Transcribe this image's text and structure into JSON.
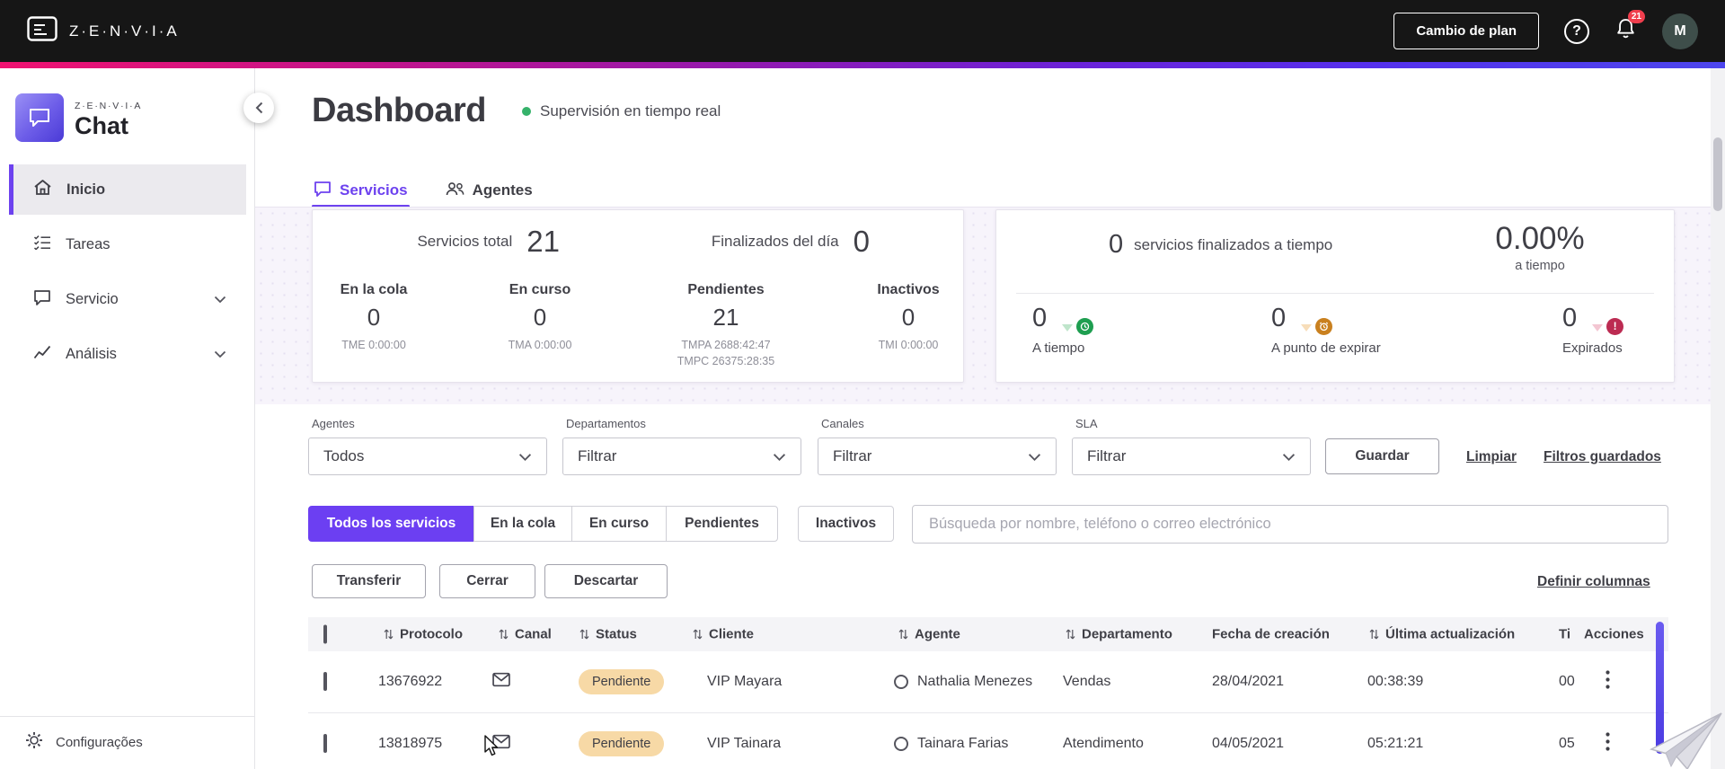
{
  "topbar": {
    "brand": "Z·E·N·V·I·A",
    "change_plan": "Cambio de plan",
    "notifications": "21",
    "avatar_initial": "M"
  },
  "sidebar": {
    "brand_small": "Z·E·N·V·I·A",
    "product": "Chat",
    "items": [
      {
        "label": "Inicio"
      },
      {
        "label": "Tareas"
      },
      {
        "label": "Servicio"
      },
      {
        "label": "Análisis"
      }
    ],
    "footer": {
      "label": "Configurações"
    }
  },
  "header": {
    "title": "Dashboard",
    "live_status": "Supervisión en tiempo real",
    "tabs": [
      {
        "label": "Servicios"
      },
      {
        "label": "Agentes"
      }
    ]
  },
  "stats": {
    "left": {
      "total_label": "Servicios total",
      "total_value": "21",
      "finished_label": "Finalizados del día",
      "finished_value": "0",
      "columns": [
        {
          "label": "En la cola",
          "value": "0",
          "sub": [
            "TME 0:00:00"
          ]
        },
        {
          "label": "En curso",
          "value": "0",
          "sub": [
            "TMA 0:00:00"
          ]
        },
        {
          "label": "Pendientes",
          "value": "21",
          "sub": [
            "TMPA 2688:42:47",
            "TMPC 26375:28:35"
          ]
        },
        {
          "label": "Inactivos",
          "value": "0",
          "sub": [
            "TMI 0:00:00"
          ]
        }
      ]
    },
    "right": {
      "on_time_value": "0",
      "on_time_label": "servicios finalizados a tiempo",
      "percent": "0.00%",
      "percent_label": "a tiempo",
      "items": [
        {
          "value": "0",
          "label": "A tiempo"
        },
        {
          "value": "0",
          "label": "A punto de expirar"
        },
        {
          "value": "0",
          "label": "Expirados"
        }
      ]
    }
  },
  "filters": {
    "agents_label": "Agentes",
    "agents_value": "Todos",
    "departments_label": "Departamentos",
    "departments_value": "Filtrar",
    "channels_label": "Canales",
    "channels_value": "Filtrar",
    "sla_label": "SLA",
    "sla_value": "Filtrar",
    "save": "Guardar",
    "clear": "Limpiar",
    "saved": "Filtros guardados"
  },
  "service_tabs": {
    "all": "Todos los servicios",
    "queue": "En la cola",
    "in_progress": "En curso",
    "pending": "Pendientes",
    "inactive": "Inactivos",
    "search_placeholder": "Búsqueda por nombre, teléfono o correo electrónico"
  },
  "bulk_actions": {
    "transfer": "Transferir",
    "close": "Cerrar",
    "discard": "Descartar",
    "define_columns": "Definir columnas"
  },
  "table": {
    "headers": {
      "protocol": "Protocolo",
      "channel": "Canal",
      "status": "Status",
      "client": "Cliente",
      "agent": "Agente",
      "department": "Departamento",
      "created": "Fecha de creación",
      "updated": "Última actualización",
      "time": "Ti",
      "actions": "Acciones"
    },
    "rows": [
      {
        "protocol": "13676922",
        "channel": "email-icon",
        "status": "Pendiente",
        "client": "VIP Mayara",
        "agent": "Nathalia Menezes",
        "department": "Vendas",
        "created": "28/04/2021",
        "updated": "00:38:39",
        "time": "00"
      },
      {
        "protocol": "13818975",
        "channel": "email-icon",
        "status": "Pendiente",
        "client": "VIP Tainara",
        "agent": "Tainara Farias",
        "department": "Atendimento",
        "created": "04/05/2021",
        "updated": "05:21:21",
        "time": "05"
      }
    ]
  },
  "colors": {
    "accent": "#6D42EF",
    "topbar_bg": "#161616",
    "gradient_left": "#F01371",
    "gradient_mid": "#9519AE",
    "gradient_right": "#4D46EE",
    "live_green": "#35B26A",
    "pending_badge_bg": "#F7D9A6",
    "sla_green": "#1E9E50",
    "sla_orange": "#C9801F",
    "sla_red": "#BC2B52"
  }
}
